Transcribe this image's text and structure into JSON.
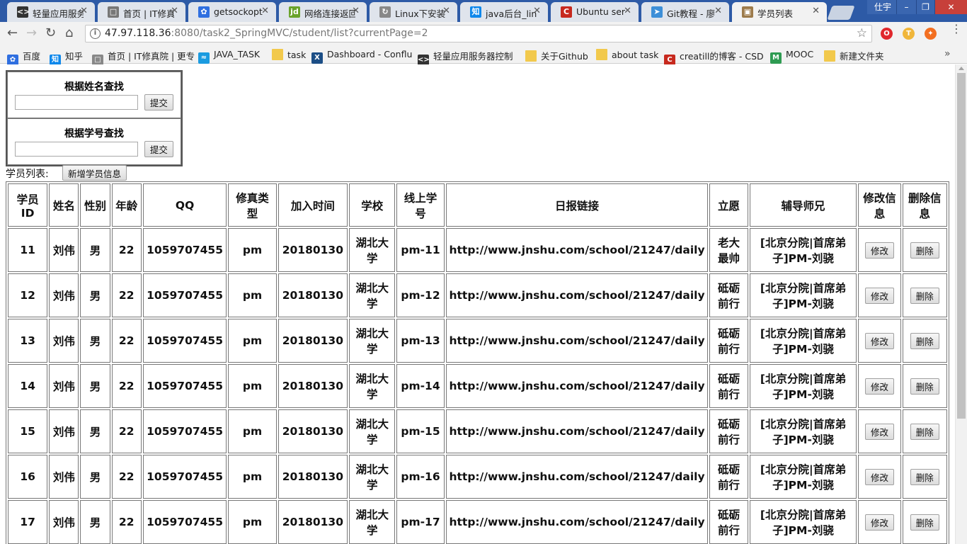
{
  "browser": {
    "tabs": [
      {
        "title": "轻量应用服务",
        "icon": "bracket-icon",
        "color": "#333333"
      },
      {
        "title": "首页 | IT修真",
        "icon": "page-icon",
        "color": "#777777"
      },
      {
        "title": "getsockopt",
        "icon": "baidu-paw-icon",
        "color": "#2f6fe0"
      },
      {
        "title": "网络连接返回",
        "icon": "jd-icon",
        "color": "#6aa32b"
      },
      {
        "title": "Linux下安装",
        "icon": "spinner-icon",
        "color": "#888888"
      },
      {
        "title": "java后台_lin",
        "icon": "zhihu-icon",
        "color": "#0f88eb"
      },
      {
        "title": "Ubuntu ser",
        "icon": "csdn-icon",
        "color": "#c7291e"
      },
      {
        "title": "Git教程 - 廖",
        "icon": "rocket-icon",
        "color": "#3d8fd8"
      },
      {
        "title": "学员列表",
        "icon": "image-icon",
        "color": "#9c7a4a"
      }
    ],
    "window_user": "仕宇",
    "url_host": "47.97.118.36",
    "url_rest": ":8080/task2_SpringMVC/student/list?currentPage=2",
    "bookmarks": [
      {
        "label": "百度",
        "icon": "baidu-paw-icon",
        "color": "#2f6fe0"
      },
      {
        "label": "知乎",
        "icon": "zhihu-icon",
        "color": "#0f88eb"
      },
      {
        "label": "首页 | IT修真院 | 更专",
        "icon": "page-icon",
        "color": "#888888"
      },
      {
        "label": "JAVA_TASK",
        "icon": "wifi-icon",
        "color": "#1b9be0"
      },
      {
        "label": "task",
        "icon": "folder-icon",
        "color": "#f2c94c"
      },
      {
        "label": "Dashboard - Conflu",
        "icon": "confluence-icon",
        "color": "#1c4e86"
      },
      {
        "label": "轻量应用服务器控制",
        "icon": "bracket-icon",
        "color": "#333333"
      },
      {
        "label": "关于Github",
        "icon": "folder-icon",
        "color": "#f2c94c"
      },
      {
        "label": "about task",
        "icon": "folder-icon",
        "color": "#f2c94c"
      },
      {
        "label": "creatill的博客 - CSD",
        "icon": "csdn-icon",
        "color": "#c7291e"
      },
      {
        "label": "MOOC",
        "icon": "mooc-icon",
        "color": "#2e9b52"
      },
      {
        "label": "新建文件夹",
        "icon": "folder-icon",
        "color": "#f2c94c"
      }
    ]
  },
  "search": {
    "by_name_title": "根据姓名查找",
    "by_id_title": "根据学号查找",
    "submit_label": "提交"
  },
  "list": {
    "label": "学员列表:",
    "add_label": "新增学员信息",
    "edit_label": "修改",
    "delete_label": "删除",
    "headers": [
      "学员ID",
      "姓名",
      "性别",
      "年龄",
      "QQ",
      "修真类型",
      "加入时间",
      "学校",
      "线上学号",
      "日报链接",
      "立愿",
      "辅导师兄",
      "修改信息",
      "删除信息"
    ],
    "rows": [
      [
        "11",
        "刘伟",
        "男",
        "22",
        "1059707455",
        "pm",
        "20180130",
        "湖北大学",
        "pm-11",
        "http://www.jnshu.com/school/21247/daily",
        "老大最帅",
        "[北京分院|首席弟子]PM-刘骁"
      ],
      [
        "12",
        "刘伟",
        "男",
        "22",
        "1059707455",
        "pm",
        "20180130",
        "湖北大学",
        "pm-12",
        "http://www.jnshu.com/school/21247/daily",
        "砥砺前行",
        "[北京分院|首席弟子]PM-刘骁"
      ],
      [
        "13",
        "刘伟",
        "男",
        "22",
        "1059707455",
        "pm",
        "20180130",
        "湖北大学",
        "pm-13",
        "http://www.jnshu.com/school/21247/daily",
        "砥砺前行",
        "[北京分院|首席弟子]PM-刘骁"
      ],
      [
        "14",
        "刘伟",
        "男",
        "22",
        "1059707455",
        "pm",
        "20180130",
        "湖北大学",
        "pm-14",
        "http://www.jnshu.com/school/21247/daily",
        "砥砺前行",
        "[北京分院|首席弟子]PM-刘骁"
      ],
      [
        "15",
        "刘伟",
        "男",
        "22",
        "1059707455",
        "pm",
        "20180130",
        "湖北大学",
        "pm-15",
        "http://www.jnshu.com/school/21247/daily",
        "砥砺前行",
        "[北京分院|首席弟子]PM-刘骁"
      ],
      [
        "16",
        "刘伟",
        "男",
        "22",
        "1059707455",
        "pm",
        "20180130",
        "湖北大学",
        "pm-16",
        "http://www.jnshu.com/school/21247/daily",
        "砥砺前行",
        "[北京分院|首席弟子]PM-刘骁"
      ],
      [
        "17",
        "刘伟",
        "男",
        "22",
        "1059707455",
        "pm",
        "20180130",
        "湖北大学",
        "pm-17",
        "http://www.jnshu.com/school/21247/daily",
        "砥砺前行",
        "[北京分院|首席弟子]PM-刘骁"
      ]
    ]
  }
}
